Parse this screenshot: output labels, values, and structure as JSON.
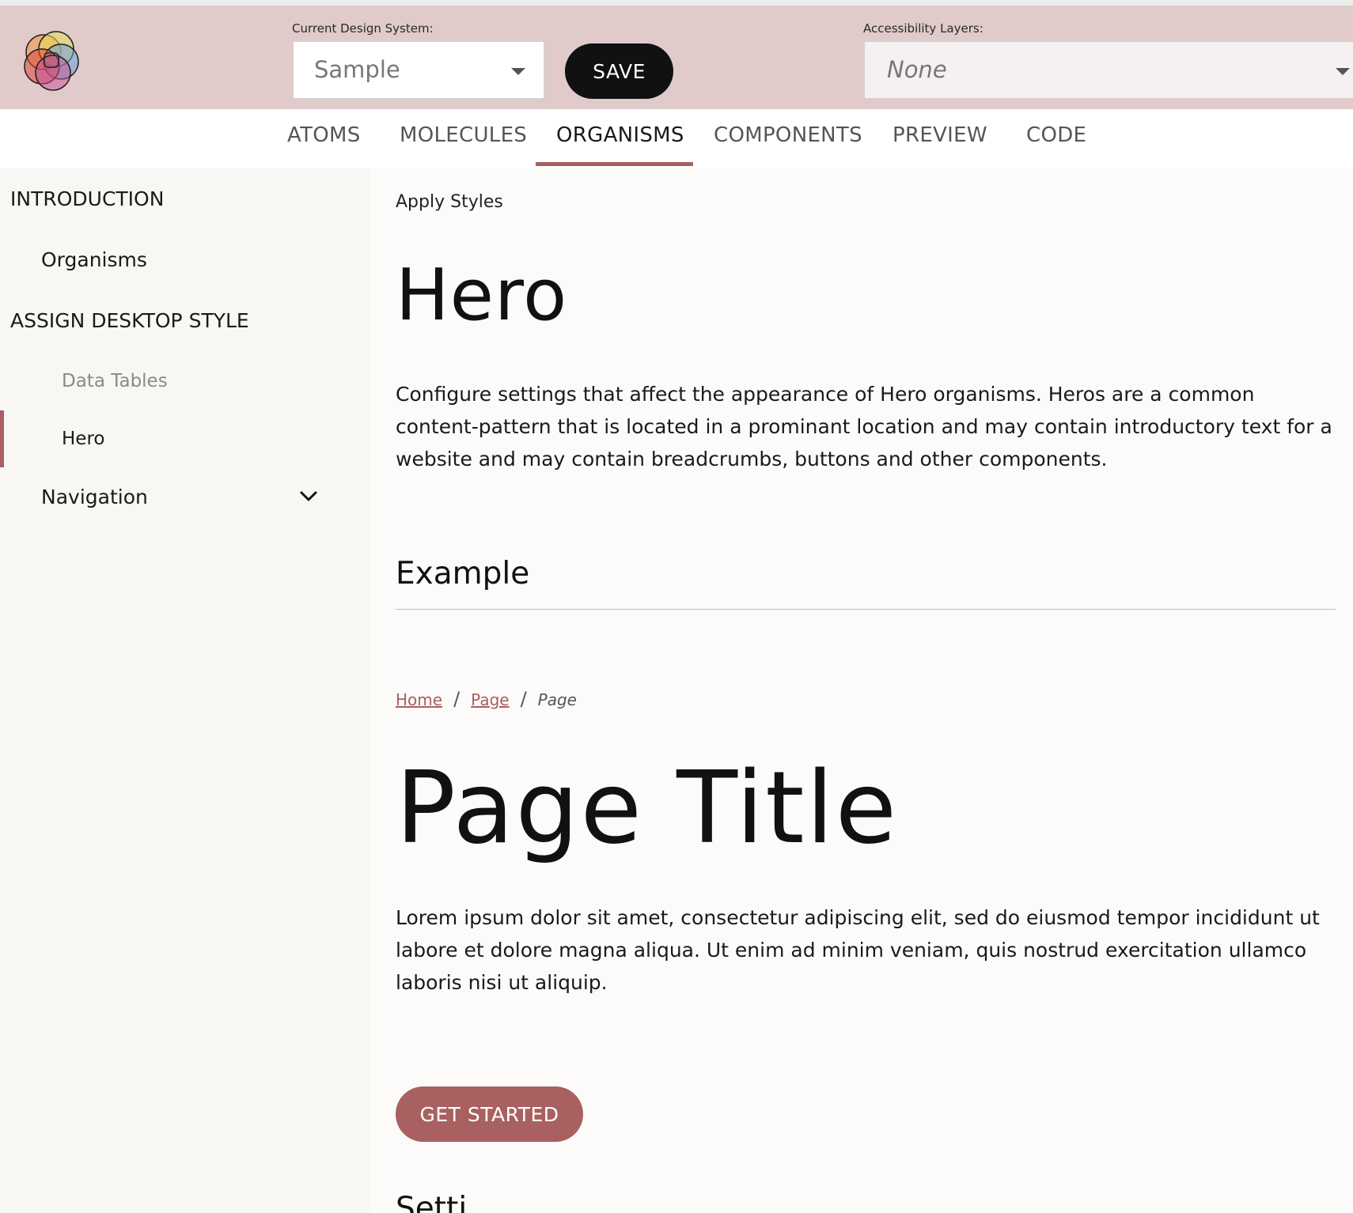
{
  "header": {
    "logo_icon": "venn-circles-logo-icon",
    "design_system_label": "Current Design System:",
    "design_system_value": "Sample",
    "save_label": "SAVE",
    "accessibility_label": "Accessibility Layers:",
    "accessibility_value": "None"
  },
  "tabs": [
    {
      "label": "ATOMS",
      "active": false
    },
    {
      "label": "MOLECULES",
      "active": false
    },
    {
      "label": "ORGANISMS",
      "active": true
    },
    {
      "label": "COMPONENTS",
      "active": false
    },
    {
      "label": "PREVIEW",
      "active": false
    },
    {
      "label": "CODE",
      "active": false
    }
  ],
  "sidebar": {
    "introduction": "INTRODUCTION",
    "organisms": "Organisms",
    "assign": "ASSIGN DESKTOP STYLE",
    "data_tables": "Data Tables",
    "hero": "Hero",
    "navigation": "Navigation",
    "navigation_icon": "chevron-down-icon"
  },
  "main": {
    "apply_styles": "Apply Styles",
    "heading": "Hero",
    "description": "Configure settings that affect the appearance of Hero organisms. Heros are a common content-pattern that is located in a prominant location and may contain introductory text for a website and may contain breadcrumbs, buttons and other components.",
    "example_heading": "Example",
    "breadcrumb": {
      "home": "Home",
      "page1": "Page",
      "current": "Page",
      "separator": "/"
    },
    "page_title": "Page Title",
    "lorem": "Lorem ipsum dolor sit amet, consectetur adipiscing elit, sed do eiusmod tempor incididunt ut labore et dolore magna aliqua. Ut enim ad minim veniam, quis nostrud exercitation ullamco laboris nisi ut aliquip.",
    "cta_label": "GET STARTED",
    "settings_heading_partial": "Setti"
  },
  "colors": {
    "header_bg": "#e0caca",
    "accent": "#a86060",
    "save_bg": "#111111"
  }
}
